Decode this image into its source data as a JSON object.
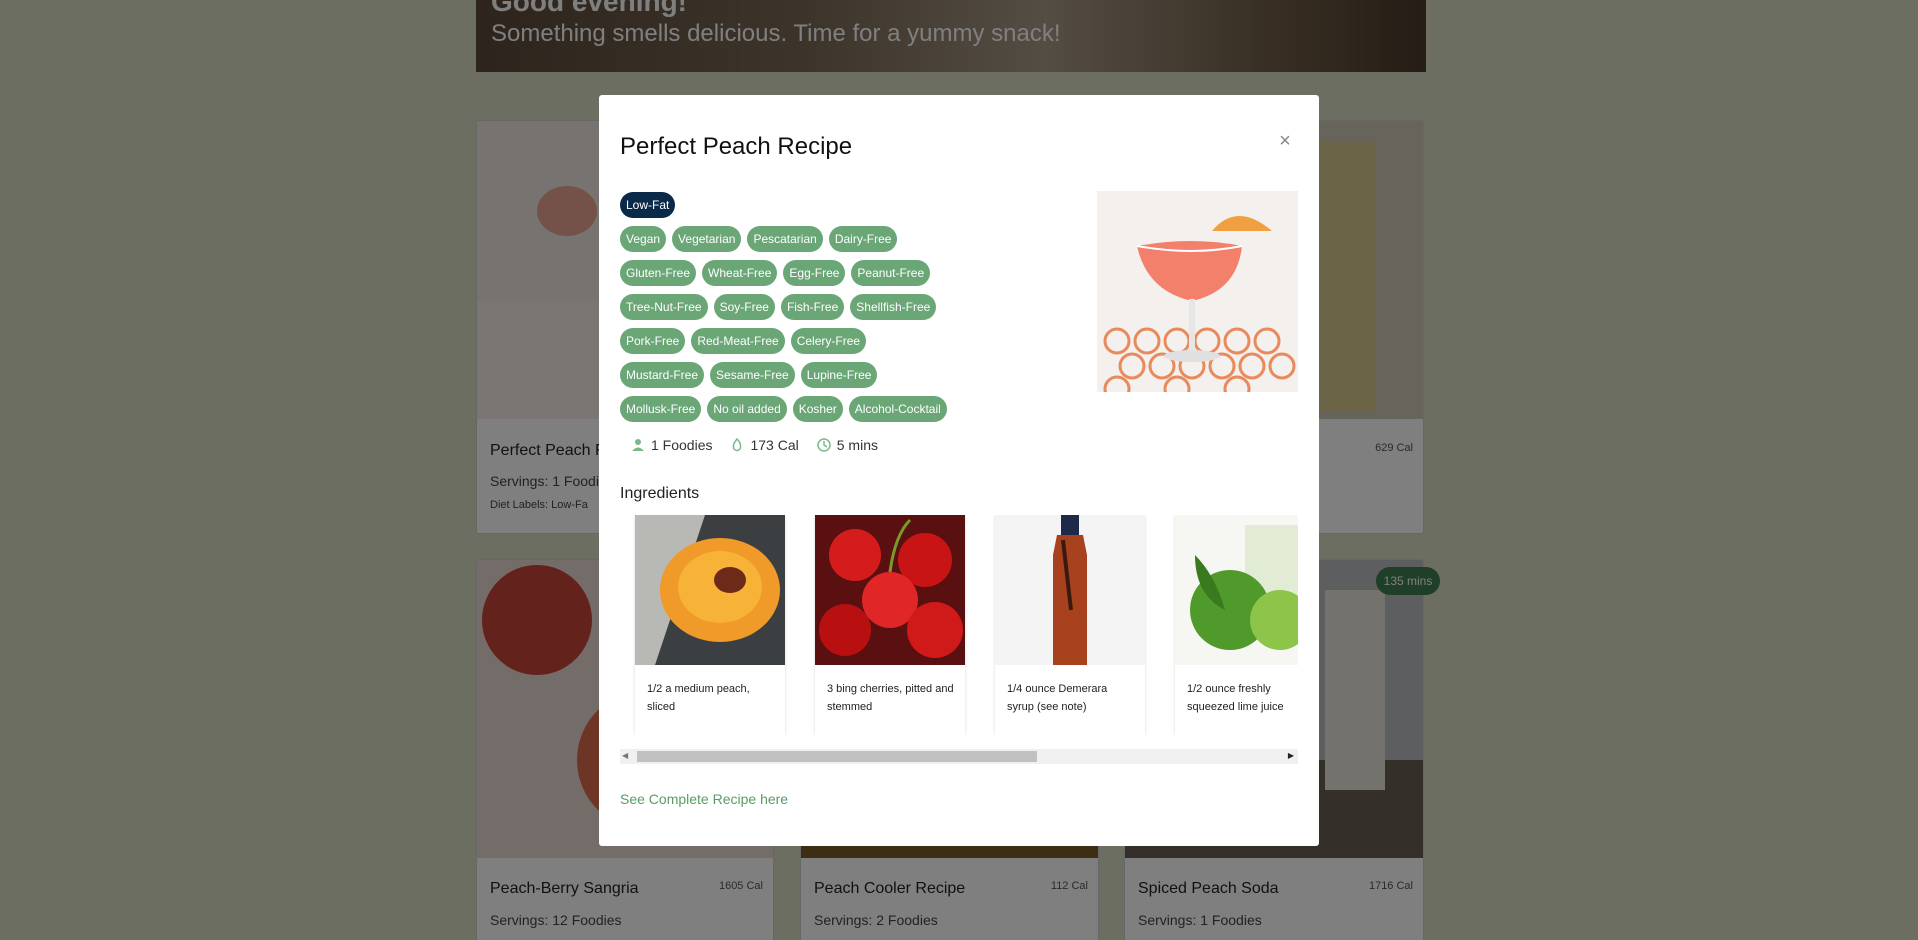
{
  "hero": {
    "title": "Good evening!",
    "subtitle": "Something smells delicious. Time for a yummy snack!"
  },
  "cards": [
    {
      "title": "Perfect Peach F",
      "servings": "Servings: 1 Foodi",
      "labels": "Diet Labels: Low-Fa"
    },
    {
      "cal": "629 Cal"
    },
    {
      "title": "Peach-Berry Sangria",
      "servings": "Servings: 12 Foodies",
      "cal": "1605 Cal"
    },
    {
      "title": "Peach Cooler Recipe",
      "servings": "Servings: 2 Foodies",
      "cal": "112 Cal"
    },
    {
      "title": "Spiced Peach Soda",
      "servings": "Servings: 1 Foodies",
      "cal": "1716 Cal",
      "mins": "135 mins"
    }
  ],
  "modal": {
    "title": "Perfect Peach Recipe",
    "close": "×",
    "label_rows": [
      [
        "Low-Fat"
      ],
      [
        "Vegan",
        "Vegetarian",
        "Pescatarian",
        "Dairy-Free"
      ],
      [
        "Gluten-Free",
        "Wheat-Free",
        "Egg-Free",
        "Peanut-Free"
      ],
      [
        "Tree-Nut-Free",
        "Soy-Free",
        "Fish-Free",
        "Shellfish-Free"
      ],
      [
        "Pork-Free",
        "Red-Meat-Free",
        "Celery-Free"
      ],
      [
        "Mustard-Free",
        "Sesame-Free",
        "Lupine-Free"
      ],
      [
        "Mollusk-Free",
        "No oil added",
        "Kosher",
        "Alcohol-Cocktail"
      ]
    ],
    "stats": {
      "servings": "1 Foodies",
      "calories": "173 Cal",
      "time": "5 mins"
    },
    "ingredients_heading": "Ingredients",
    "ingredients": [
      {
        "text": "1/2 a medium peach, sliced"
      },
      {
        "text": "3 bing cherries, pitted and stemmed"
      },
      {
        "text": "1/4 ounce Demerara syrup (see note)"
      },
      {
        "text": "1/2 ounce freshly squeezed lime juice"
      }
    ],
    "see_link": "See Complete Recipe here",
    "scroll_position": 0.62
  },
  "colors": {
    "label_green": "#6aa676",
    "label_dark": "#0b2a4a",
    "link_green": "#5a9c66",
    "badge_green": "#3f7e50"
  },
  "icons": [
    "person-icon",
    "flame-icon",
    "clock-icon",
    "close-icon",
    "arrow-left-icon",
    "arrow-right-icon"
  ]
}
